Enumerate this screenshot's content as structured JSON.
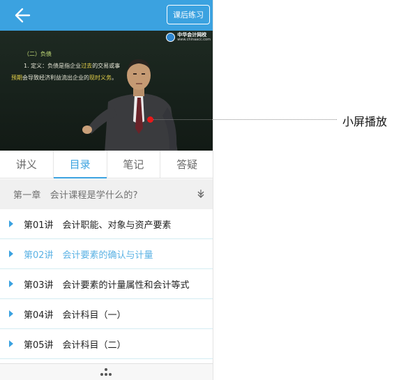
{
  "header": {
    "back_icon": "arrow-left-icon",
    "exercise_button": "课后练习"
  },
  "video": {
    "logo_cn": "中华会计网校",
    "logo_url": "www.chinaacc.com",
    "blackboard": {
      "heading": "（二）负债",
      "def_prefix": "1. 定义：负债是指企业",
      "def_hl": "过去",
      "def_suffix": "的交易或事",
      "def_tail": "为。",
      "l3_hl1": "预期",
      "l3_mid": "会导致经济利益流出企业的",
      "l3_hl2": "现时义务",
      "l3_end": "。"
    }
  },
  "tabs": [
    {
      "label": "讲义"
    },
    {
      "label": "目录"
    },
    {
      "label": "笔记"
    },
    {
      "label": "答疑"
    }
  ],
  "chapter": {
    "title": "第一章　会计课程是学什么的?",
    "toggle_icon": "collapse-arrow-icon"
  },
  "lessons": [
    {
      "text": "第01讲　会计职能、对象与资产要素"
    },
    {
      "text": "第02讲　会计要素的确认与计量"
    },
    {
      "text": "第03讲　会计要素的计量属性和会计等式"
    },
    {
      "text": "第04讲　会计科目（一）"
    },
    {
      "text": "第05讲　会计科目（二）"
    }
  ],
  "bottom": {
    "more_icon": "more-dots-icon"
  },
  "annotation": {
    "label": "小屏播放"
  },
  "colors": {
    "accent": "#3ba2e0",
    "active_lesson": "#5bb2e4",
    "marker": "#e8191a"
  }
}
